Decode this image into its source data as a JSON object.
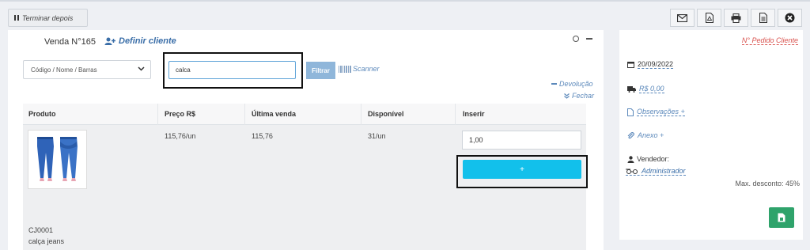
{
  "toolbar": {
    "defer_label": "Terminar depois",
    "icons": [
      "envelope-icon",
      "pdf-icon",
      "printer-icon",
      "document-icon",
      "close-circle-icon"
    ]
  },
  "sale": {
    "title": "Venda N°165",
    "define_client": "Definir cliente"
  },
  "search": {
    "mode_selected": "Código / Nome / Barras",
    "query": "calca",
    "filter_label": "Filtrar",
    "scanner_label": "Scanner"
  },
  "links": {
    "devolucao": "Devolução",
    "fechar": "Fechar"
  },
  "table": {
    "headers": [
      "Produto",
      "Preço R$",
      "Última venda",
      "Disponível",
      "Inserir"
    ],
    "rows": [
      {
        "code": "CJ0001",
        "name": "calça jeans",
        "price": "115,76/un",
        "last_sale": "115,76",
        "available": "31/un",
        "quantity": "1,00",
        "add_label": "+"
      }
    ]
  },
  "side": {
    "order_number_label": "N° Pedido Cliente",
    "date": "20/09/2022",
    "shipping": "R$ 0,00",
    "notes": "Observações +",
    "attachment": "Anexo +",
    "seller_label": "Vendedor:",
    "seller_name": "Administrador",
    "max_discount": "Max. desconto: 45%"
  },
  "colors": {
    "accent": "#12c0eb",
    "link": "#5c89bb",
    "danger": "#d9534f",
    "success": "#2fa36b"
  }
}
